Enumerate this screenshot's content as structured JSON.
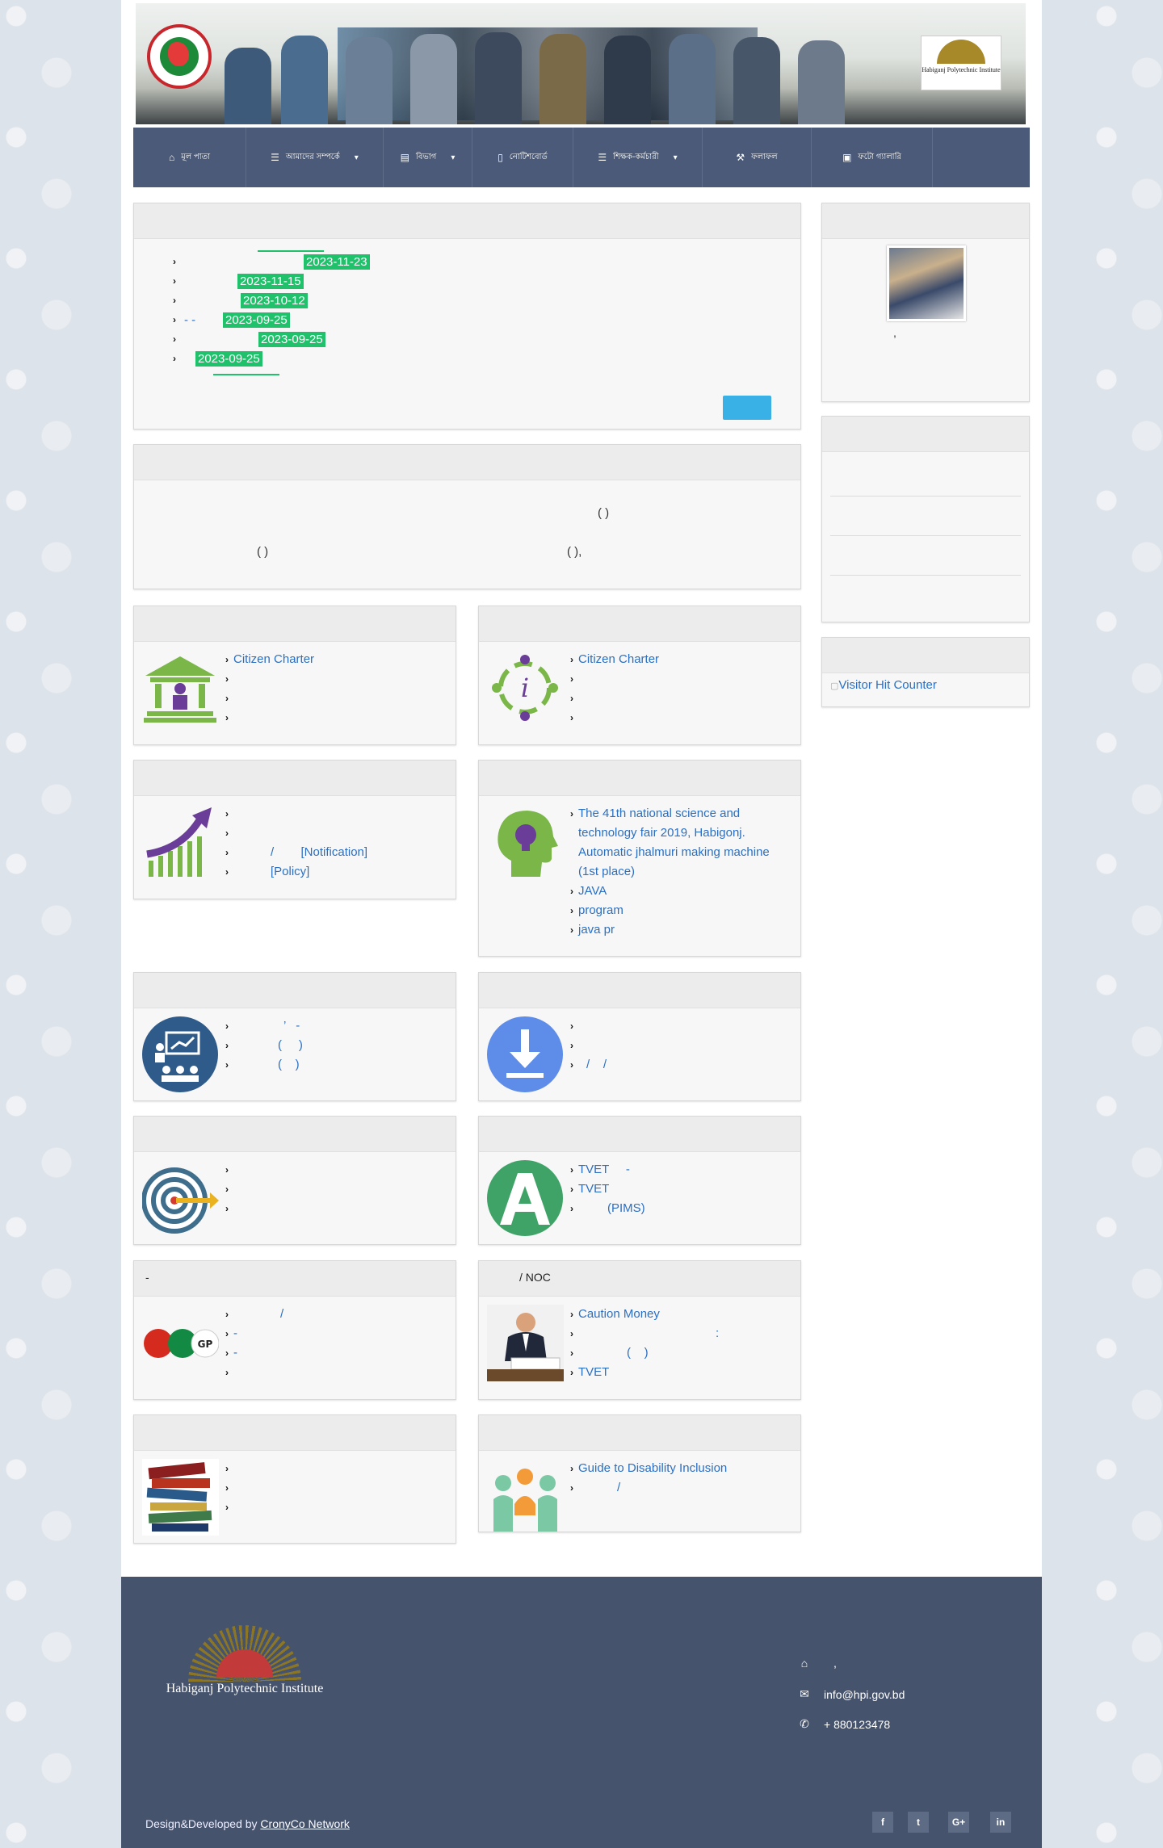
{
  "nav": {
    "items": [
      {
        "label": "মূল পাতা",
        "icon": "home-icon",
        "dropdown": false
      },
      {
        "label": "আমাদের সম্পর্কে",
        "icon": "list-icon",
        "dropdown": true
      },
      {
        "label": "বিভাগ",
        "icon": "list-alt-icon",
        "dropdown": true
      },
      {
        "label": "নোটিশবোর্ড",
        "icon": "clipboard-icon",
        "dropdown": false
      },
      {
        "label": "শিক্ষক-কর্মচারী",
        "icon": "list-icon",
        "dropdown": true
      },
      {
        "label": "ফলাফল",
        "icon": "gavel-icon",
        "dropdown": false
      },
      {
        "label": "ফটো গ্যালারি",
        "icon": "picture-icon",
        "dropdown": false
      }
    ]
  },
  "notices": [
    {
      "date": "2023-11-23"
    },
    {
      "date": "2023-11-15"
    },
    {
      "date": "2023-10-12"
    },
    {
      "prefix": "- -",
      "date": "2023-09-25"
    },
    {
      "date": "2023-09-25"
    },
    {
      "date": "2023-09-25"
    }
  ],
  "about": {
    "line1": "(    )",
    "line2a": "(  )",
    "line2b": "(                    ),"
  },
  "principal": {
    "caption": ","
  },
  "counter": {
    "alt": "Visitor Hit Counter"
  },
  "boxes": {
    "b1": {
      "items": [
        "Citizen Charter",
        "",
        "",
        ""
      ]
    },
    "b2": {
      "items": [
        "Citizen Charter",
        "",
        "",
        ""
      ]
    },
    "b3": {
      "items": [
        "",
        "",
        "/        [Notification]",
        "[Policy]"
      ]
    },
    "b4": {
      "items": [
        "The 41th national science and technology fair 2019, Habigonj. Automatic jhalmuri making machine (1st place)",
        "JAVA",
        "program",
        "java pr"
      ]
    },
    "b5": {
      "items": [
        "’   -",
        "(     )",
        "(    )"
      ]
    },
    "b6": {
      "items": [
        "",
        "",
        "/    /"
      ]
    },
    "b7": {
      "items": [
        "",
        "",
        ""
      ]
    },
    "b8": {
      "items": [
        "TVET     -",
        "TVET",
        "(PIMS)"
      ]
    },
    "b9": {
      "title": "-",
      "items": [
        "/",
        "-",
        "-",
        ""
      ]
    },
    "b10": {
      "title": "/ NOC",
      "items": [
        "Caution Money",
        ":",
        "(    )",
        "TVET"
      ]
    },
    "b11": {
      "items": [
        "",
        "",
        ""
      ]
    },
    "b12": {
      "items": [
        "Guide to Disability Inclusion",
        "/"
      ]
    }
  },
  "footer": {
    "logo_text": "Habiganj Polytechnic Institute",
    "address": ",",
    "email": "info@hpi.gov.bd",
    "phone": "+ 880123478",
    "credit_prefix": "Design&Developed by",
    "credit_link": "CronyCo Network",
    "social": [
      "f",
      "t",
      "G+",
      "in"
    ]
  },
  "header": {
    "hpi_logo_text": "Habiganj Polytechnic Institute"
  }
}
